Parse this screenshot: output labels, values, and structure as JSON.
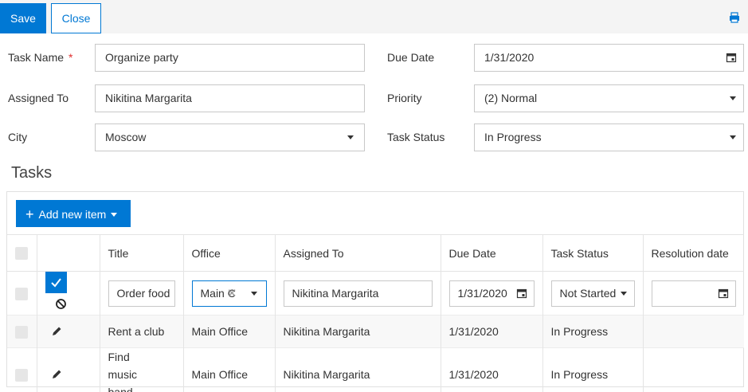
{
  "toolbar": {
    "save_label": "Save",
    "close_label": "Close",
    "print_icon": "print-pdf-icon"
  },
  "form": {
    "task_name": {
      "label": "Task Name",
      "required_mark": "*",
      "value": "Organize party"
    },
    "assigned_to": {
      "label": "Assigned To",
      "value": "Nikitina Margarita"
    },
    "city": {
      "label": "City",
      "value": "Moscow"
    },
    "due_date": {
      "label": "Due Date",
      "value": "1/31/2020"
    },
    "priority": {
      "label": "Priority",
      "value": "(2) Normal"
    },
    "task_status": {
      "label": "Task Status",
      "value": "In Progress"
    }
  },
  "tasks": {
    "title": "Tasks",
    "add_button_label": "Add new item",
    "columns": [
      "Title",
      "Office",
      "Assigned To",
      "Due Date",
      "Task Status",
      "Resolution date"
    ],
    "edit_row": {
      "title": "Order food",
      "office": "Main C",
      "assigned_to": "Nikitina Margarita",
      "due_date": "1/31/2020",
      "task_status": "Not Started",
      "resolution_date": ""
    },
    "rows": [
      {
        "title": "Rent a club",
        "office": "Main Office",
        "assigned_to": "Nikitina Margarita",
        "due_date": "1/31/2020",
        "task_status": "In Progress",
        "resolution_date": ""
      },
      {
        "title": "Find music band",
        "office": "Main Office",
        "assigned_to": "Nikitina Margarita",
        "due_date": "1/31/2020",
        "task_status": "In Progress",
        "resolution_date": ""
      }
    ]
  },
  "colors": {
    "accent": "#0078d4",
    "required": "#e03030",
    "toolbar_bg": "#f4f4f4"
  }
}
